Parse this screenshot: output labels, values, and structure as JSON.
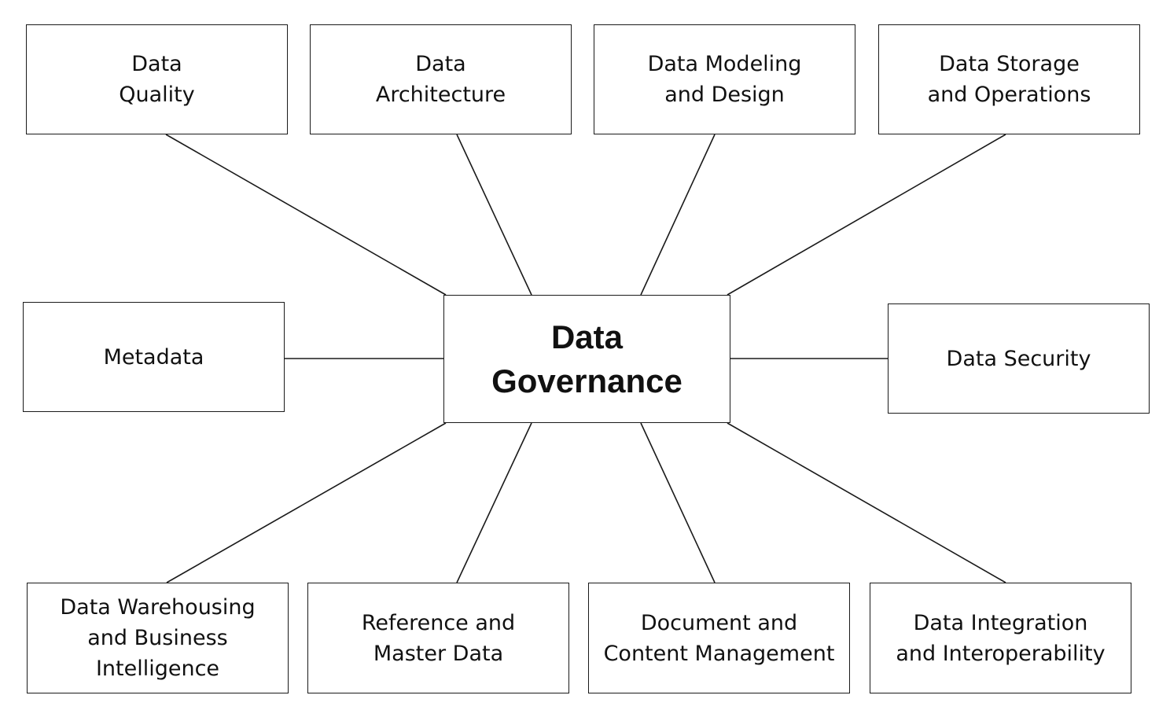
{
  "diagram": {
    "center": {
      "label": "Data\nGovernance"
    },
    "nodes": {
      "quality": {
        "label": "Data\nQuality"
      },
      "architecture": {
        "label": "Data\nArchitecture"
      },
      "modeling": {
        "label": "Data Modeling\nand Design"
      },
      "storage": {
        "label": "Data Storage\nand Operations"
      },
      "metadata": {
        "label": "Metadata"
      },
      "security": {
        "label": "Data Security"
      },
      "warehousing": {
        "label": "Data Warehousing\nand Business\nIntelligence"
      },
      "reference": {
        "label": "Reference and\nMaster Data"
      },
      "document": {
        "label": "Document and\nContent Management"
      },
      "integration": {
        "label": "Data Integration\nand Interoperability"
      }
    },
    "edges": [
      {
        "from": "center",
        "to": "quality"
      },
      {
        "from": "center",
        "to": "architecture"
      },
      {
        "from": "center",
        "to": "modeling"
      },
      {
        "from": "center",
        "to": "storage"
      },
      {
        "from": "center",
        "to": "metadata"
      },
      {
        "from": "center",
        "to": "security"
      },
      {
        "from": "center",
        "to": "warehousing"
      },
      {
        "from": "center",
        "to": "reference"
      },
      {
        "from": "center",
        "to": "document"
      },
      {
        "from": "center",
        "to": "integration"
      }
    ]
  }
}
